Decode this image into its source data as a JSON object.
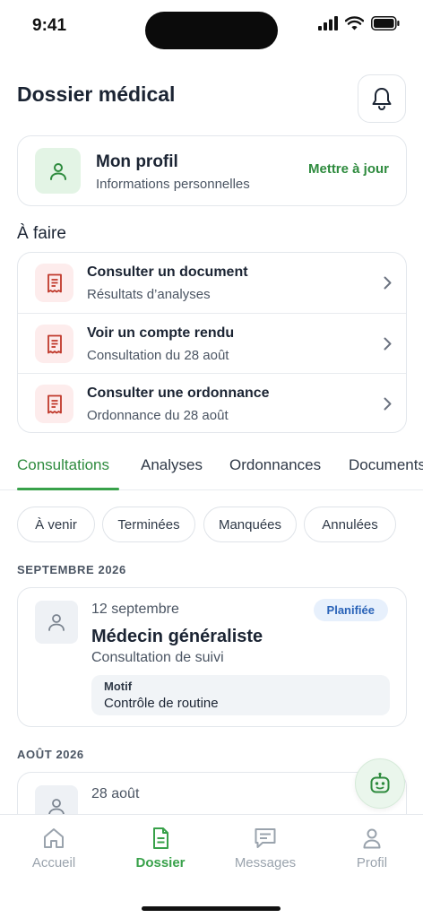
{
  "status_bar": {
    "time": "9:41"
  },
  "header": {
    "title": "Dossier médical",
    "bell_icon": "bell-icon"
  },
  "profile": {
    "title": "Mon profil",
    "subtitle": "Informations personnelles",
    "action": "Mettre à jour",
    "icon": "user-icon"
  },
  "todo": {
    "title": "À faire",
    "items": [
      {
        "label": "Consulter un document",
        "subtitle": "Résultats d’analyses",
        "icon": "receipt-icon"
      },
      {
        "label": "Voir un compte rendu",
        "subtitle": "Consultation du 28 août",
        "icon": "receipt-icon"
      },
      {
        "label": "Consulter une ordonnance",
        "subtitle": "Ordonnance du 28 août",
        "icon": "receipt-icon"
      }
    ]
  },
  "tabs": {
    "items": [
      "Consultations",
      "Analyses",
      "Ordonnances",
      "Documents"
    ],
    "active": "Consultations"
  },
  "filters": [
    "À venir",
    "Terminées",
    "Manquées",
    "Annulées"
  ],
  "sections": [
    {
      "label": "SEPTEMBRE 2026",
      "appointment": {
        "date": "12 septembre",
        "status": "Planifiée",
        "title": "Médecin généraliste",
        "subtitle": "Consultation de suivi",
        "motif_label": "Motif",
        "motif_value": "Contrôle de routine"
      }
    },
    {
      "label": "AOÛT 2026",
      "appointment": {
        "date": "28 août"
      }
    }
  ],
  "bottom_nav": {
    "items": [
      {
        "label": "Accueil",
        "icon": "home-icon"
      },
      {
        "label": "Dossier",
        "icon": "document-icon"
      },
      {
        "label": "Messages",
        "icon": "message-icon"
      },
      {
        "label": "Profil",
        "icon": "user-icon"
      }
    ],
    "active": "Dossier"
  },
  "colors": {
    "accent": "#38a14a",
    "accent_text": "#2e8b3e",
    "todo_icon": "#c0392b",
    "badge_bg": "#e7f0fc",
    "badge_text": "#2a63b8"
  }
}
